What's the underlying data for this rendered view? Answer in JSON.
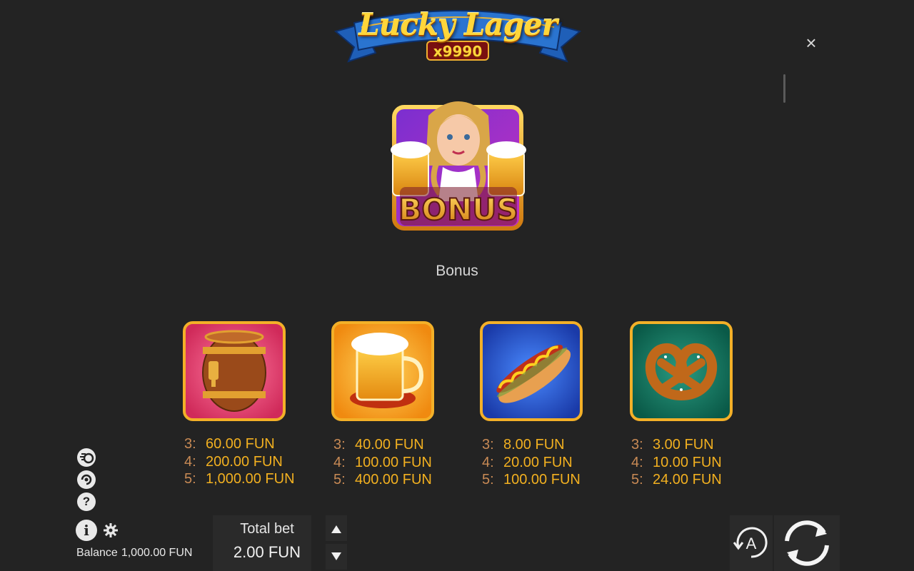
{
  "logo": {
    "title": "Lucky Lager",
    "multiplier": "x9990"
  },
  "bonus": {
    "symbol_text": "BONUS",
    "caption": "Bonus"
  },
  "paytable": [
    {
      "symbol": "beer-barrel",
      "payouts": [
        {
          "count": "3:",
          "amount": "60.00 FUN"
        },
        {
          "count": "4:",
          "amount": "200.00 FUN"
        },
        {
          "count": "5:",
          "amount": "1,000.00 FUN"
        }
      ]
    },
    {
      "symbol": "beer-mug",
      "payouts": [
        {
          "count": "3:",
          "amount": "40.00 FUN"
        },
        {
          "count": "4:",
          "amount": "100.00 FUN"
        },
        {
          "count": "5:",
          "amount": "400.00 FUN"
        }
      ]
    },
    {
      "symbol": "hot-dog",
      "payouts": [
        {
          "count": "3:",
          "amount": "8.00 FUN"
        },
        {
          "count": "4:",
          "amount": "20.00 FUN"
        },
        {
          "count": "5:",
          "amount": "100.00 FUN"
        }
      ]
    },
    {
      "symbol": "pretzel",
      "payouts": [
        {
          "count": "3:",
          "amount": "3.00 FUN"
        },
        {
          "count": "4:",
          "amount": "10.00 FUN"
        },
        {
          "count": "5:",
          "amount": "24.00 FUN"
        }
      ]
    }
  ],
  "controls": {
    "close_glyph": "×",
    "info_glyph": "i",
    "help_glyph": "?",
    "autoplay_glyph": "A",
    "balance_label": "Balance",
    "balance_value": "1,000.00 FUN",
    "total_bet_label": "Total bet",
    "total_bet_value": "2.00 FUN"
  },
  "colors": {
    "background": "#232323",
    "payout_amount": "#f2b020",
    "payout_count": "#c88a55",
    "panel": "#2a2a2a"
  }
}
